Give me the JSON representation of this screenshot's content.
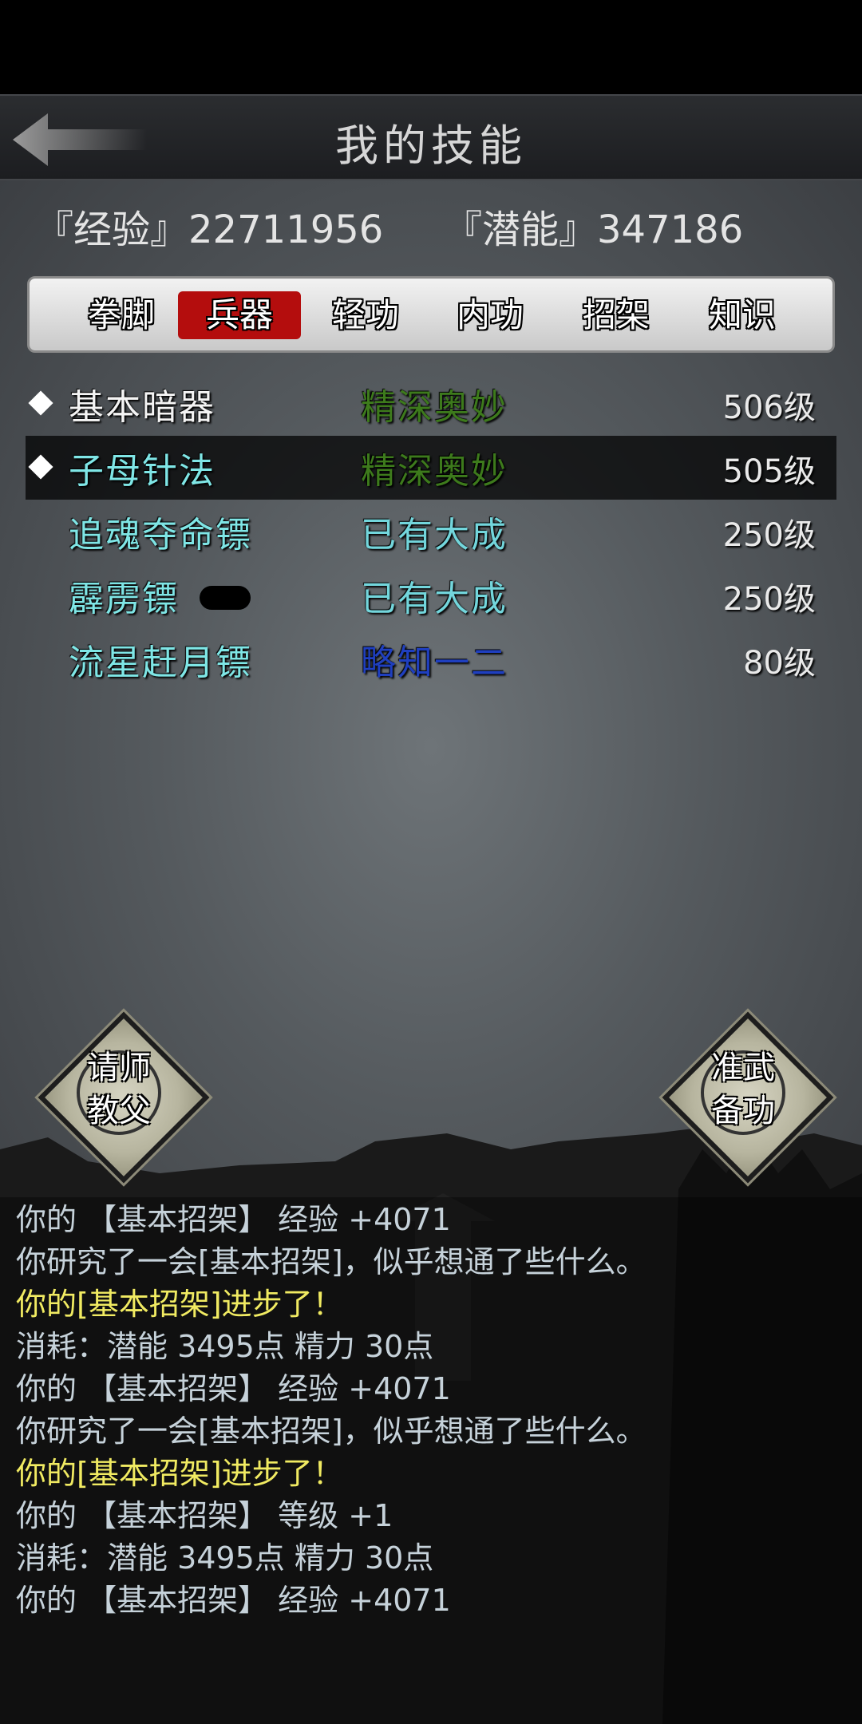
{
  "header": {
    "title": "我的技能"
  },
  "stats": {
    "exp_label": "『经验』",
    "exp_value": "22711956",
    "pot_label": "『潜能』",
    "pot_value": "347186"
  },
  "tabs": [
    "拳脚",
    "兵器",
    "轻功",
    "内功",
    "招架",
    "知识"
  ],
  "active_tab": "兵器",
  "skills": [
    {
      "name": "基本暗器",
      "rank": "精深奥妙",
      "level": "506级",
      "marked": true,
      "selected": false
    },
    {
      "name": "子母针法",
      "rank": "精深奥妙",
      "level": "505级",
      "marked": true,
      "selected": true
    },
    {
      "name": "追魂夺命镖",
      "rank": "已有大成",
      "level": "250级",
      "marked": false,
      "selected": false
    },
    {
      "name": "霹雳镖",
      "rank": "已有大成",
      "level": "250级",
      "marked": false,
      "selected": false
    },
    {
      "name": "流星赶月镖",
      "rank": "略知一二",
      "level": "80级",
      "marked": false,
      "selected": false
    }
  ],
  "colors": {
    "rank_deep": "#3d7a1c",
    "rank_great": "#73d6dc",
    "rank_little": "#1f3fbf",
    "tab_active": "#b40d0d",
    "log_yellow": "#f1eb62"
  },
  "buttons": {
    "left": "请师\n教父",
    "right": "准武\n备功"
  },
  "log": [
    {
      "text": "你的 【基本招架】 经验 +4071",
      "style": "normal"
    },
    {
      "text": "你研究了一会[基本招架]，似乎想通了些什么。",
      "style": "normal"
    },
    {
      "text": "你的[基本招架]进步了！",
      "style": "yellow"
    },
    {
      "text": "消耗：潜能 3495点  精力 30点",
      "style": "normal"
    },
    {
      "text": "你的 【基本招架】 经验 +4071",
      "style": "normal"
    },
    {
      "text": "你研究了一会[基本招架]，似乎想通了些什么。",
      "style": "normal"
    },
    {
      "text": "你的[基本招架]进步了！",
      "style": "yellow"
    },
    {
      "text": "你的 【基本招架】 等级 +1",
      "style": "normal"
    },
    {
      "text": "消耗：潜能 3495点  精力 30点",
      "style": "normal"
    },
    {
      "text": "你的 【基本招架】 经验 +4071",
      "style": "normal"
    }
  ]
}
